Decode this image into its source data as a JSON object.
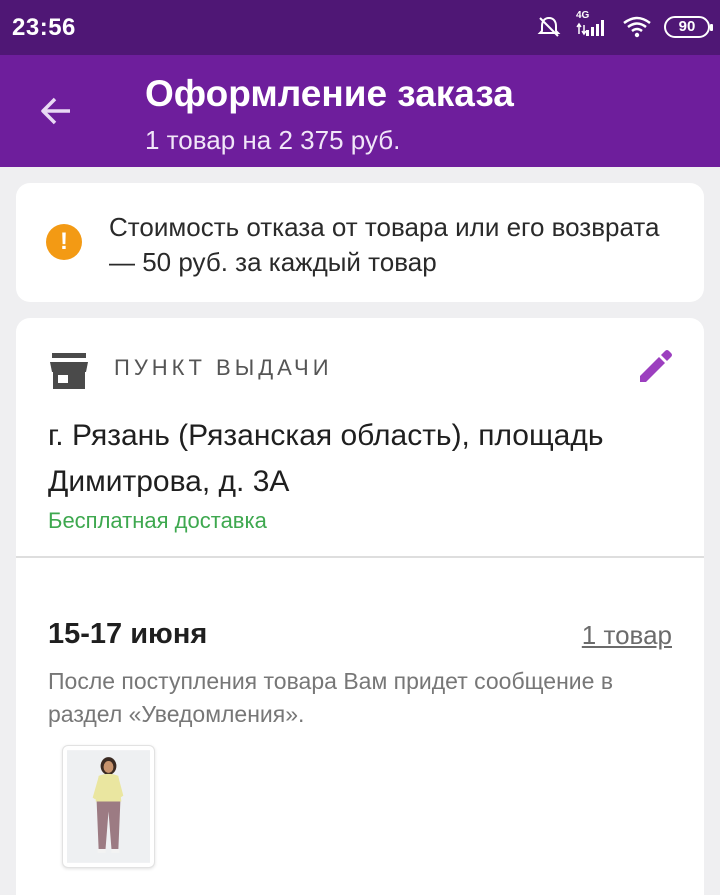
{
  "status_bar": {
    "time": "23:56",
    "network": "4G",
    "battery": "90",
    "icons": [
      "alarm-off-icon",
      "signal-icon",
      "wifi-icon",
      "battery-icon"
    ]
  },
  "app_bar": {
    "title": "Оформление заказа",
    "subtitle": "1 товар на 2 375 руб.",
    "background_color": "#6e1e9c",
    "back_icon": "arrow-left-icon"
  },
  "notice": {
    "icon": "warning-icon",
    "icon_color": "#f39a14",
    "text": "Стоимость отказа от товара или его возврата — 50 руб. за каждый товар"
  },
  "pickup": {
    "section_label": "ПУНКТ ВЫДАЧИ",
    "section_icon": "store-icon",
    "edit_icon": "pencil-icon",
    "address": "г. Рязань (Рязанская область), площадь Димитрова, д. 3А",
    "delivery_note": "Бесплатная доставка",
    "delivery_color": "#3ea84f"
  },
  "shipment": {
    "date": "15-17 июня",
    "items_link": "1 товар",
    "note": "После поступления товара Вам придет сообщение в раздел «Уведомления».",
    "products": [
      {
        "thumbnail": "product-photo-woman-in-yellow-top-and-mauve-pants"
      }
    ]
  }
}
